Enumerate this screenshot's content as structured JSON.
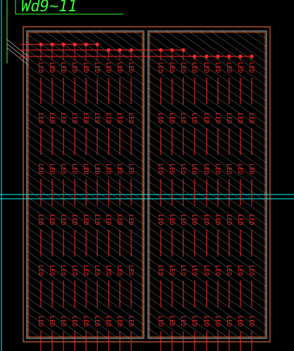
{
  "drawing": {
    "title_label": "Wd9~11",
    "fixture_label": "LED",
    "colors": {
      "background": "#000000",
      "outline": "#ff7a33",
      "panel_border": "#bfbfbf",
      "hatch": "#8a8a8a",
      "fixture": "#ff2a2a",
      "text_label": "#33ff33",
      "guide_line": "#00ffff",
      "wire": "#ff2a2a"
    },
    "panels": [
      {
        "name": "left-panel",
        "columns": 9,
        "rows": 6
      },
      {
        "name": "right-panel",
        "columns": 9,
        "rows": 6
      }
    ]
  }
}
